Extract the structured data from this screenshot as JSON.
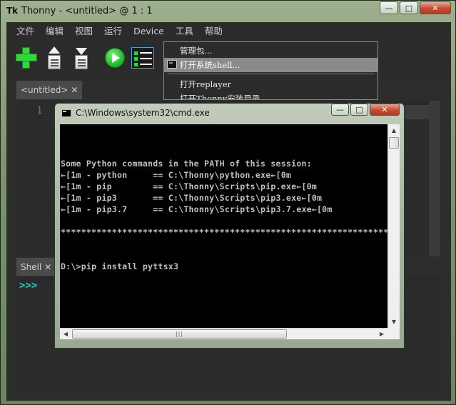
{
  "window": {
    "app_icon": "Tk",
    "title": "Thonny  -  <untitled>  @  1 : 1",
    "minimize": "—",
    "maximize": "□",
    "close": "✕"
  },
  "menubar": {
    "items": [
      "文件",
      "编辑",
      "视图",
      "运行",
      "Device",
      "工具",
      "帮助"
    ]
  },
  "toolbar": {
    "icons": [
      "new-file-icon",
      "open-file-icon",
      "save-file-icon",
      "run-icon",
      "debug-icon"
    ]
  },
  "editor": {
    "tab_label": "<untitled>",
    "tab_close": "✕",
    "line_number": "1"
  },
  "shell": {
    "tab_label": "Shell",
    "tab_close": "✕",
    "prompt": ">>>"
  },
  "tools_menu": {
    "items": [
      {
        "label": "管理包...",
        "highlighted": false
      },
      {
        "label": "打开系统shell...",
        "highlighted": true
      },
      {
        "label": "打开replayer",
        "highlighted": false
      },
      {
        "label": "打开Thonny安装目录...",
        "highlighted": false
      }
    ]
  },
  "cmd_window": {
    "title": "C:\\Windows\\system32\\cmd.exe",
    "minimize": "—",
    "maximize": "□",
    "close": "✕",
    "console_lines": [
      "Some Python commands in the PATH of this session:",
      "←[1m - python     == C:\\Thonny\\python.exe←[0m",
      "←[1m - pip        == C:\\Thonny\\Scripts\\pip.exe←[0m",
      "←[1m - pip3       == C:\\Thonny\\Scripts\\pip3.exe←[0m",
      "←[1m - pip3.7     == C:\\Thonny\\Scripts\\pip3.7.exe←[0m",
      "",
      "********************************************************************",
      "",
      "",
      "D:\\>pip install pyttsx3"
    ]
  }
}
